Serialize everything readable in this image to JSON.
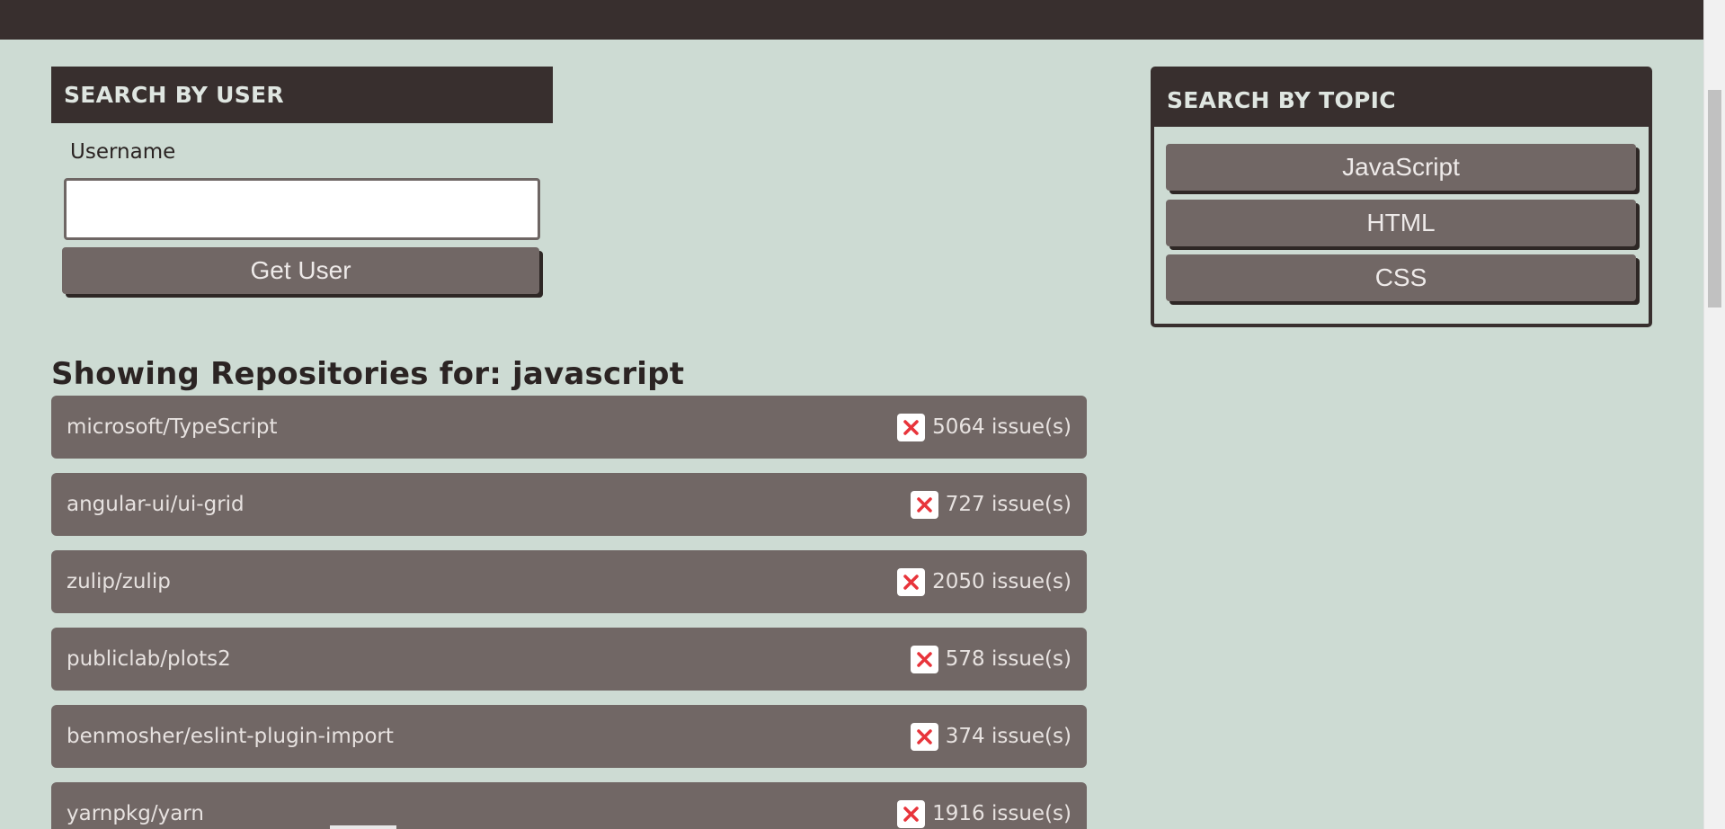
{
  "search_user": {
    "header": "SEARCH BY USER",
    "username_label": "Username",
    "username_value": "",
    "button_label": "Get User"
  },
  "search_topic": {
    "header": "SEARCH BY TOPIC",
    "topics": [
      "JavaScript",
      "HTML",
      "CSS"
    ]
  },
  "repos": {
    "heading": "Showing Repositories for: javascript",
    "items": [
      {
        "name": "microsoft/TypeScript",
        "issues": "5064 issue(s)",
        "icon": "x-icon"
      },
      {
        "name": "angular-ui/ui-grid",
        "issues": "727 issue(s)",
        "icon": "x-icon"
      },
      {
        "name": "zulip/zulip",
        "issues": "2050 issue(s)",
        "icon": "x-icon"
      },
      {
        "name": "publiclab/plots2",
        "issues": "578 issue(s)",
        "icon": "x-icon"
      },
      {
        "name": "benmosher/eslint-plugin-import",
        "issues": "374 issue(s)",
        "icon": "x-icon"
      },
      {
        "name": "yarnpkg/yarn",
        "issues": "1916 issue(s)",
        "icon": "x-icon"
      }
    ]
  },
  "colors": {
    "background": "#cddbd3",
    "dark": "#382f2e",
    "card": "#716765",
    "issue_icon": "#e8343b"
  }
}
